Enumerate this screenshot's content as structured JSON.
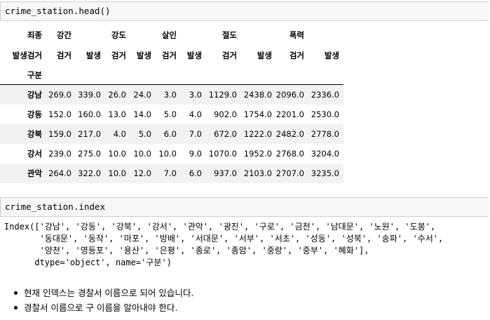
{
  "cell1": {
    "code": "crime_station.head()"
  },
  "dataframe": {
    "header_top": [
      "죄종",
      "강간",
      "강도",
      "살인",
      "절도",
      "폭력"
    ],
    "header_mid": [
      "발생검거",
      "검거",
      "발생",
      "검거",
      "발생",
      "검거",
      "발생",
      "검거",
      "발생",
      "검거",
      "발생"
    ],
    "header_idx": "구분",
    "rows": [
      {
        "index": "강남",
        "values": [
          "269.0",
          "339.0",
          "26.0",
          "24.0",
          "3.0",
          "3.0",
          "1129.0",
          "2438.0",
          "2096.0",
          "2336.0"
        ]
      },
      {
        "index": "강동",
        "values": [
          "152.0",
          "160.0",
          "13.0",
          "14.0",
          "5.0",
          "4.0",
          "902.0",
          "1754.0",
          "2201.0",
          "2530.0"
        ]
      },
      {
        "index": "강북",
        "values": [
          "159.0",
          "217.0",
          "4.0",
          "5.0",
          "6.0",
          "7.0",
          "672.0",
          "1222.0",
          "2482.0",
          "2778.0"
        ]
      },
      {
        "index": "강서",
        "values": [
          "239.0",
          "275.0",
          "10.0",
          "10.0",
          "10.0",
          "9.0",
          "1070.0",
          "1952.0",
          "2768.0",
          "3204.0"
        ]
      },
      {
        "index": "관악",
        "values": [
          "264.0",
          "322.0",
          "10.0",
          "12.0",
          "7.0",
          "6.0",
          "937.0",
          "2103.0",
          "2707.0",
          "3235.0"
        ]
      }
    ]
  },
  "cell2": {
    "code": "crime_station.index"
  },
  "output": {
    "lines": [
      "Index(['강남', '강동', '강북', '강서', '관악', '광진', '구로', '금천', '남대문', '노원', '도봉',",
      "       '동대문', '동작', '마포', '방배', '서대문', '서부', '서초', '성동', '성북', '송파', '수서',",
      "       '양천', '영등포', '용산', '은평', '종로', '종암', '중랑', '중부', '혜화'],",
      "      dtype='object', name='구분')"
    ]
  },
  "notes": [
    "현재 인덱스는 경찰서 이름으로 되어 있습니다.",
    "경찰서 이름으로 구 이름을 알아내야 한다."
  ]
}
